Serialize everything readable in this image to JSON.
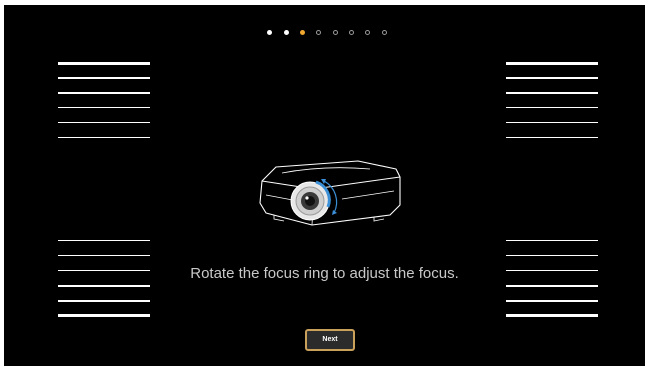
{
  "wizard": {
    "step_count": 8,
    "current_step": 3,
    "instruction": "Rotate the focus ring to adjust the focus.",
    "next_label": "Next"
  },
  "colors": {
    "background": "#000000",
    "active_dot": "#f0a830",
    "button_border": "#c9a15a",
    "lens_ring": "#3b8fd6",
    "instruction_text": "#c8c8c8"
  },
  "icons": {
    "illustration": "projector-focus-ring-icon"
  }
}
